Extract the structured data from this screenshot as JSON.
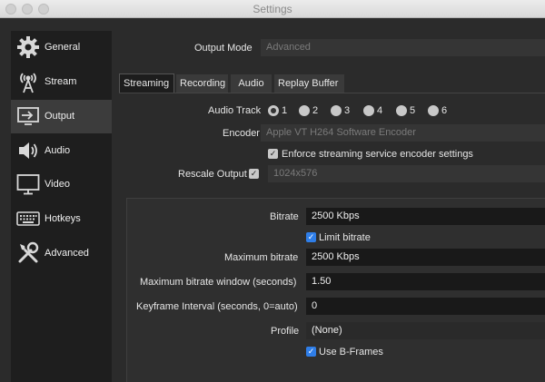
{
  "window": {
    "title": "Settings"
  },
  "sidebar": {
    "items": [
      {
        "label": "General",
        "icon": "gear-icon"
      },
      {
        "label": "Stream",
        "icon": "antenna-icon"
      },
      {
        "label": "Output",
        "icon": "output-icon"
      },
      {
        "label": "Audio",
        "icon": "speaker-icon"
      },
      {
        "label": "Video",
        "icon": "monitor-icon"
      },
      {
        "label": "Hotkeys",
        "icon": "keyboard-icon"
      },
      {
        "label": "Advanced",
        "icon": "tools-icon"
      }
    ],
    "active": "Output"
  },
  "output_mode": {
    "label": "Output Mode",
    "value": "Advanced"
  },
  "tabs": [
    {
      "label": "Streaming"
    },
    {
      "label": "Recording"
    },
    {
      "label": "Audio"
    },
    {
      "label": "Replay Buffer"
    }
  ],
  "active_tab": "Streaming",
  "streaming": {
    "audio_track": {
      "label": "Audio Track",
      "options": [
        "1",
        "2",
        "3",
        "4",
        "5",
        "6"
      ],
      "selected": "1"
    },
    "encoder": {
      "label": "Encoder",
      "value": "Apple VT H264 Software Encoder"
    },
    "enforce": {
      "label": "Enforce streaming service encoder settings",
      "checked": true
    },
    "rescale": {
      "label": "Rescale Output",
      "checked": true,
      "value": "1024x576"
    }
  },
  "encoder_settings": {
    "bitrate": {
      "label": "Bitrate",
      "value": "2500 Kbps"
    },
    "limit_bitrate": {
      "label": "Limit bitrate",
      "checked": true
    },
    "max_bitrate": {
      "label": "Maximum bitrate",
      "value": "2500 Kbps"
    },
    "max_bitrate_window": {
      "label": "Maximum bitrate window (seconds)",
      "value": "1.50"
    },
    "keyframe_interval": {
      "label": "Keyframe Interval (seconds, 0=auto)",
      "value": "0"
    },
    "profile": {
      "label": "Profile",
      "value": "(None)"
    },
    "b_frames": {
      "label": "Use B-Frames",
      "checked": true
    }
  },
  "colors": {
    "accent": "#2f7ee8",
    "panel": "#2b2b2b",
    "sidebar": "#1e1e1e",
    "field": "#191919"
  }
}
